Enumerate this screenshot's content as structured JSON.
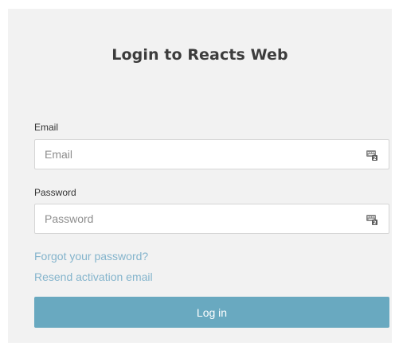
{
  "form": {
    "title": "Login to Reacts Web",
    "email": {
      "label": "Email",
      "placeholder": "Email",
      "value": "",
      "icon": "keyboard-icon"
    },
    "password": {
      "label": "Password",
      "placeholder": "Password",
      "value": "",
      "icon": "keyboard-icon"
    },
    "forgot_password_link": "Forgot your password?",
    "resend_activation_link": "Resend activation email",
    "login_button": "Log in"
  },
  "colors": {
    "panel_bg": "#f2f2f2",
    "link": "#84b4cc",
    "button_bg": "#69a9c0",
    "title_text": "#3c3c3c"
  }
}
